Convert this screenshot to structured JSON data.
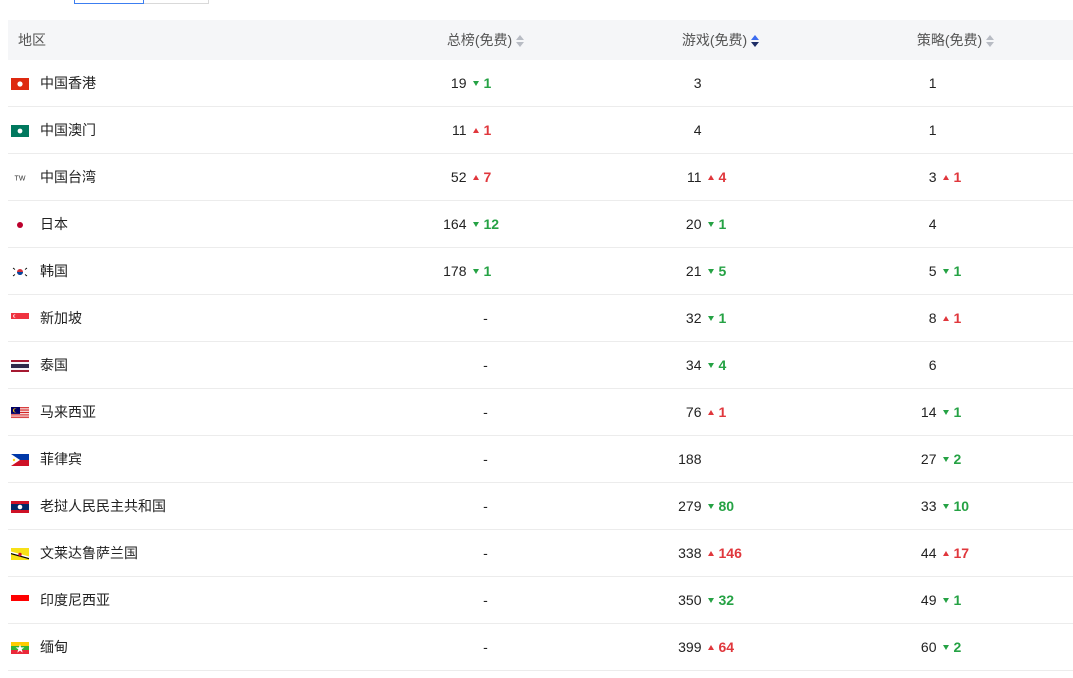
{
  "header": {
    "region": "地区",
    "overall": "总榜(免费)",
    "games": "游戏(免费)",
    "strategy": "策略(免费)"
  },
  "rows": [
    {
      "region": "中国香港",
      "flag": "hk",
      "overall": {
        "rank": "19",
        "delta": "1",
        "dir": "down"
      },
      "games": {
        "rank": "3"
      },
      "strategy": {
        "rank": "1"
      }
    },
    {
      "region": "中国澳门",
      "flag": "mo",
      "overall": {
        "rank": "11",
        "delta": "1",
        "dir": "up"
      },
      "games": {
        "rank": "4"
      },
      "strategy": {
        "rank": "1"
      }
    },
    {
      "region": "中国台湾",
      "flag": "tw",
      "flag_text": "TW",
      "overall": {
        "rank": "52",
        "delta": "7",
        "dir": "up"
      },
      "games": {
        "rank": "11",
        "delta": "4",
        "dir": "up"
      },
      "strategy": {
        "rank": "3",
        "delta": "1",
        "dir": "up"
      }
    },
    {
      "region": "日本",
      "flag": "jp",
      "overall": {
        "rank": "164",
        "delta": "12",
        "dir": "down"
      },
      "games": {
        "rank": "20",
        "delta": "1",
        "dir": "down"
      },
      "strategy": {
        "rank": "4"
      }
    },
    {
      "region": "韩国",
      "flag": "kr",
      "overall": {
        "rank": "178",
        "delta": "1",
        "dir": "down"
      },
      "games": {
        "rank": "21",
        "delta": "5",
        "dir": "down"
      },
      "strategy": {
        "rank": "5",
        "delta": "1",
        "dir": "down"
      }
    },
    {
      "region": "新加坡",
      "flag": "sg",
      "overall": {
        "rank": "-"
      },
      "games": {
        "rank": "32",
        "delta": "1",
        "dir": "down"
      },
      "strategy": {
        "rank": "8",
        "delta": "1",
        "dir": "up"
      }
    },
    {
      "region": "泰国",
      "flag": "th",
      "overall": {
        "rank": "-"
      },
      "games": {
        "rank": "34",
        "delta": "4",
        "dir": "down"
      },
      "strategy": {
        "rank": "6"
      }
    },
    {
      "region": "马来西亚",
      "flag": "my",
      "overall": {
        "rank": "-"
      },
      "games": {
        "rank": "76",
        "delta": "1",
        "dir": "up"
      },
      "strategy": {
        "rank": "14",
        "delta": "1",
        "dir": "down"
      }
    },
    {
      "region": "菲律宾",
      "flag": "ph",
      "overall": {
        "rank": "-"
      },
      "games": {
        "rank": "188"
      },
      "strategy": {
        "rank": "27",
        "delta": "2",
        "dir": "down"
      }
    },
    {
      "region": "老挝人民民主共和国",
      "flag": "la",
      "overall": {
        "rank": "-"
      },
      "games": {
        "rank": "279",
        "delta": "80",
        "dir": "down"
      },
      "strategy": {
        "rank": "33",
        "delta": "10",
        "dir": "down"
      }
    },
    {
      "region": "文莱达鲁萨兰国",
      "flag": "bn",
      "overall": {
        "rank": "-"
      },
      "games": {
        "rank": "338",
        "delta": "146",
        "dir": "up"
      },
      "strategy": {
        "rank": "44",
        "delta": "17",
        "dir": "up"
      }
    },
    {
      "region": "印度尼西亚",
      "flag": "id",
      "overall": {
        "rank": "-"
      },
      "games": {
        "rank": "350",
        "delta": "32",
        "dir": "down"
      },
      "strategy": {
        "rank": "49",
        "delta": "1",
        "dir": "down"
      }
    },
    {
      "region": "缅甸",
      "flag": "mm",
      "overall": {
        "rank": "-"
      },
      "games": {
        "rank": "399",
        "delta": "64",
        "dir": "up"
      },
      "strategy": {
        "rank": "60",
        "delta": "2",
        "dir": "down"
      }
    }
  ]
}
